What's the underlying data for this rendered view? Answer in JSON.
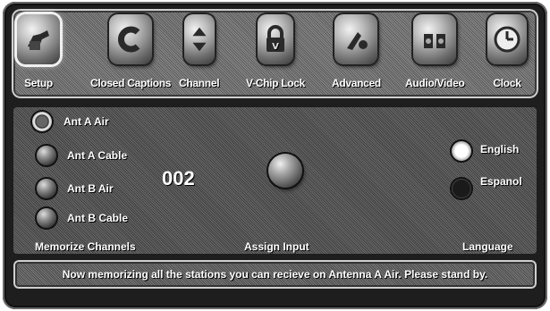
{
  "menu": {
    "items": [
      {
        "label": "Setup",
        "icon": "setup-icon"
      },
      {
        "label": "Closed Captions",
        "icon": "closed-captions-icon"
      },
      {
        "label": "Channel",
        "icon": "channel-arrows-icon"
      },
      {
        "label": "V-Chip Lock",
        "icon": "padlock-icon"
      },
      {
        "label": "Advanced",
        "icon": "advanced-icon"
      },
      {
        "label": "Audio/Video",
        "icon": "audio-video-icon"
      },
      {
        "label": "Clock",
        "icon": "clock-icon"
      }
    ],
    "active": "Setup"
  },
  "memorize": {
    "options": [
      {
        "label": "Ant A Air",
        "selected": true
      },
      {
        "label": "Ant A Cable",
        "selected": false
      },
      {
        "label": "Ant B Air",
        "selected": false
      },
      {
        "label": "Ant B Cable",
        "selected": false
      }
    ],
    "section_label": "Memorize Channels"
  },
  "channel_number": "002",
  "assign": {
    "section_label": "Assign Input"
  },
  "language": {
    "options": [
      {
        "label": "English",
        "selected": true
      },
      {
        "label": "Espanol",
        "selected": false
      }
    ],
    "section_label": "Language"
  },
  "status": {
    "message": "Now memorizing all the stations you can recieve on Antenna A Air.  Please stand by."
  }
}
